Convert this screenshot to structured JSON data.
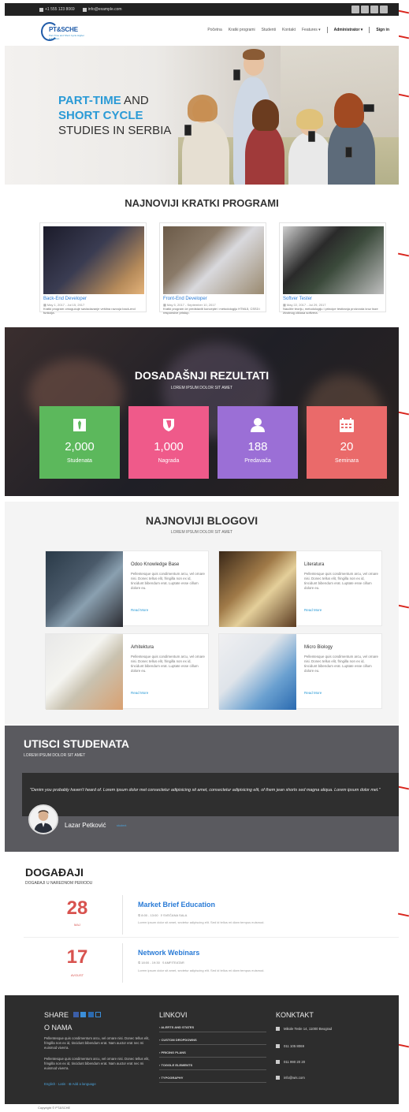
{
  "topbar": {
    "phone": "+1 555 123 8069",
    "email": "info@example.com"
  },
  "header": {
    "logo_text": "PT&SCHE",
    "logo_sub": "Part-Time and Short Cycle Higher Education",
    "nav": [
      "Početna",
      "Kratki programi",
      "Studenti",
      "Kontakt",
      "Features",
      "Administrator",
      "Sign in"
    ]
  },
  "hero": {
    "line1_hl": "PART-TIME",
    "line1_rest": " AND",
    "line2_hl": "SHORT CYCLE",
    "line3": "STUDIES IN SERBIA"
  },
  "programs": {
    "title": "NAJNOVIJI KRATKI PROGRAMI",
    "items": [
      {
        "title": "Back-End Developer",
        "date": "May 1, 2017 - Jul 15, 2017",
        "desc": "Kratki program omogućuje savladavanje veština razvoja back-end funkcija."
      },
      {
        "title": "Front-End Developer",
        "date": "May 5, 2017 - September 10, 2017",
        "desc": "Kratki program će predstaviti koncepte i metodologiju HTML5, CSS3 i responsive pristup."
      },
      {
        "title": "Softver Tester",
        "date": "May 22, 2017 - Jul 29, 2017",
        "desc": "Naučite teoriju, metodologiju i principe testiranja proizvoda kroz faze životnog ciklusa softvera."
      }
    ]
  },
  "results": {
    "title": "DOSADAŠNJI REZULTATI",
    "subtitle": "LOREM IPSUM DOLOR SIT AMET",
    "stats": [
      {
        "num": "2,000",
        "label": "Studenata",
        "icon": "tie-icon",
        "color": "#5cb85c"
      },
      {
        "num": "1,000",
        "label": "Nagrada",
        "icon": "shield-icon",
        "color": "#ef5a8a"
      },
      {
        "num": "188",
        "label": "Predavača",
        "icon": "user-icon",
        "color": "#9b6fd6"
      },
      {
        "num": "20",
        "label": "Seminara",
        "icon": "calendar-icon",
        "color": "#ea6a6a"
      }
    ]
  },
  "blogs": {
    "title": "NAJNOVIJI BLOGOVI",
    "subtitle": "LOREM IPSUM DOLOR SIT AMET",
    "read_more": "Read More",
    "text": "Pellentesque quis condimentum arcu, vel ornare nisi. Donec tellus elit, fringilla non ex id, tincidunt bibendum erat. Luptate esse cillum dolore eu.",
    "items": [
      {
        "title": "Odoo Knowledge Base"
      },
      {
        "title": "Literatura"
      },
      {
        "title": "Arhitektura"
      },
      {
        "title": "Micro Biology"
      }
    ]
  },
  "testimonials": {
    "title": "UTISCI STUDENATA",
    "subtitle": "LOREM IPSUM DOLOR SIT AMET",
    "quote": "\"Denim you probably haven't heard of. Lorem ipsum dolor met consectetur adipisicing sit amet, consectetur adipisicing elit, of them jean shorts sed magna aliqua. Lorem ipsum dolor met.\"",
    "name": "Lazar Petković",
    "role": "student"
  },
  "events": {
    "title": "DOGAĐAJI",
    "subtitle": "DOGAĐAJI U NAREDNOM PERIODU",
    "items": [
      {
        "day": "28",
        "month": "MAJ",
        "title": "Market Brief Education",
        "time": "8:00 - 13:00",
        "place": "SVEČANA SALA",
        "desc": "Lorem ipsum dolor sit amet, sectetur adipiscing elit. Sed id tellus mi diam tempus euismod."
      },
      {
        "day": "17",
        "month": "AVGUST",
        "title": "Network Webinars",
        "time": "18:00 - 19:30",
        "place": "AMFITEATAR",
        "desc": "Lorem ipsum dolor sit amet, sectetur adipiscing elit. Sed id tellus mi diam tempus euismod."
      }
    ]
  },
  "footer": {
    "share": "SHARE",
    "about_title": "O NAMA",
    "about_p": "Pellentesque quis condimentum arcu, vel ornare nisi. Donec tellus elit, fringilla non ex id, tincidunt bibendum erat. Nam auctor erat nec mi euismod viverra.",
    "lang": "English · Latin · ⊕ Add a language",
    "links_title": "LINKOVI",
    "links": [
      "ALERTS AND STATES",
      "CUSTOM DROPDOWNS",
      "PRICING PLANS",
      "TOGGLE ELEMENTS",
      "TYPOGRAPHY"
    ],
    "contact_title": "KONKTAKT",
    "address": "Mikole Tesle 14, 11000 Beograd",
    "phone": "011 105 8069",
    "fax": "011 990 20 20",
    "email": "info@wis.com",
    "copyright": "Copyright © PT&SCHE"
  }
}
